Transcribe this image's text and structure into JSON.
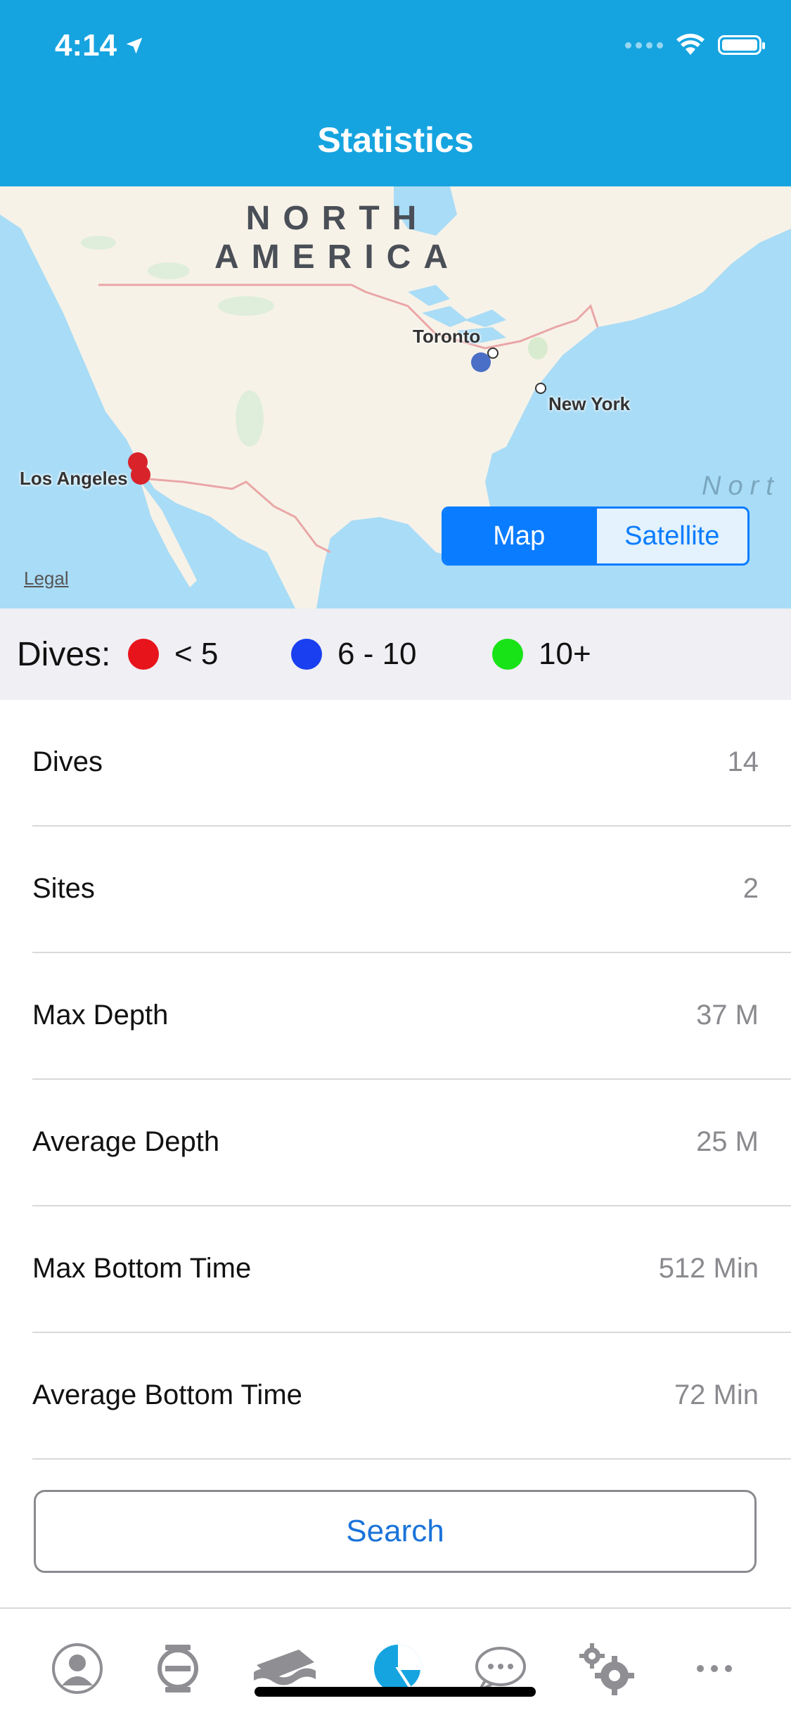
{
  "status_bar": {
    "time": "4:14"
  },
  "header": {
    "title": "Statistics"
  },
  "map": {
    "continent_label_line1": "NORTH",
    "continent_label_line2": "AMERICA",
    "cities": {
      "toronto": "Toronto",
      "new_york": "New York",
      "los_angeles": "Los Angeles"
    },
    "ocean_label": "Nort",
    "legal": "Legal",
    "toggle": {
      "map": "Map",
      "satellite": "Satellite",
      "selected": "Map"
    }
  },
  "legend": {
    "label": "Dives:",
    "items": [
      {
        "label": "< 5",
        "color": "#e8141b"
      },
      {
        "label": "6 - 10",
        "color": "#1a3ff0"
      },
      {
        "label": "10+",
        "color": "#17e317"
      }
    ]
  },
  "stats": [
    {
      "label": "Dives",
      "value": "14"
    },
    {
      "label": "Sites",
      "value": "2"
    },
    {
      "label": "Max Depth",
      "value": "37 M"
    },
    {
      "label": "Average Depth",
      "value": "25 M"
    },
    {
      "label": "Max Bottom Time",
      "value": "512 Min"
    },
    {
      "label": "Average Bottom Time",
      "value": "72 Min"
    }
  ],
  "search_button": "Search",
  "tabs": [
    {
      "icon": "profile-icon"
    },
    {
      "icon": "dive-computer-icon"
    },
    {
      "icon": "logbook-icon"
    },
    {
      "icon": "statistics-pie-icon",
      "active": true
    },
    {
      "icon": "chat-icon"
    },
    {
      "icon": "settings-gears-icon"
    },
    {
      "icon": "more-icon"
    }
  ],
  "colors": {
    "header": "#16a4e0",
    "accent": "#0a7cff",
    "tab_active": "#16a4e0",
    "tab_inactive": "#8e8e93"
  }
}
